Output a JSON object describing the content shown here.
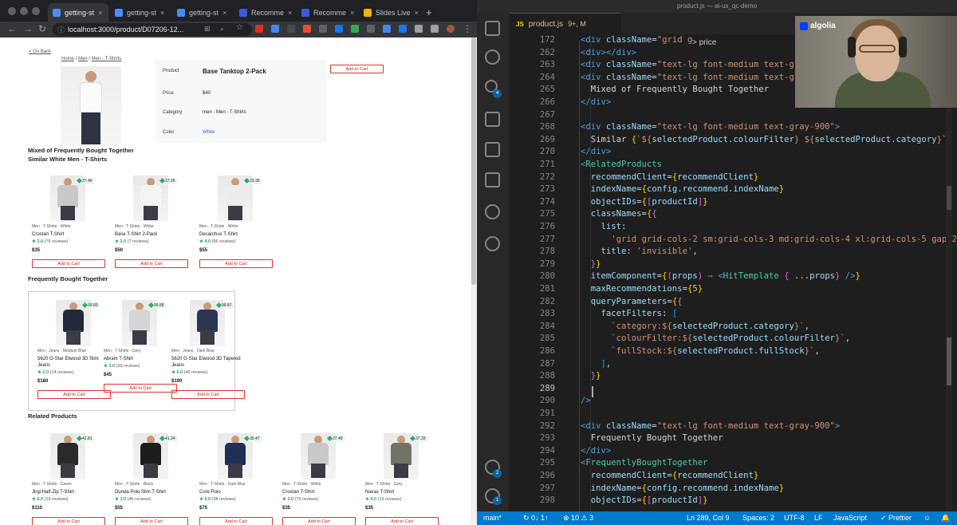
{
  "browser": {
    "tabs": [
      {
        "label": "getting-st",
        "fav": "#4a8cff"
      },
      {
        "label": "getting-st",
        "fav": "#4a8cff"
      },
      {
        "label": "getting-st",
        "fav": "#4a8cff"
      },
      {
        "label": "Recomme",
        "fav": "#3b5bdb"
      },
      {
        "label": "Recomme",
        "fav": "#3b5bdb"
      },
      {
        "label": "Slides Live",
        "fav": "#f4b400"
      }
    ],
    "new_tab": "+",
    "url": "localhost:3000/product/D07206-12..."
  },
  "page": {
    "back_link": "< Go Back",
    "breadcrumb": {
      "home": "Home",
      "sep1": " / ",
      "men": "Men",
      "sep2": " / ",
      "tshirts": "Men - T-Shirts"
    },
    "detail": {
      "product_label": "Product",
      "product_value": "Base Tanktop 2-Pack",
      "price_label": "Price",
      "price_value": "$40",
      "category_label": "Category",
      "category_value": "men - Men - T-Shirts",
      "color_label": "Color",
      "color_value": "White"
    },
    "add_to_cart": "Add to Cart",
    "heading_mixed": "Mixed of Frequently Bought Together",
    "heading_similar": "Similar White Men - T-Shirts",
    "heading_fbt": "Frequently Bought Together",
    "heading_related": "Related Products",
    "similar": [
      {
        "score": "37.49",
        "tags": "Men · T-Shirts · White",
        "name": "Crostan T-Shirt",
        "stars": "★ 2.0",
        "reviews": "(76 reviews)",
        "price": "$35",
        "shirt": "#c9c9c9"
      },
      {
        "score": "37.26",
        "tags": "Men · T-Shirts · White",
        "name": "Base T-Shirt 2-Pack",
        "stars": "★ 2.0",
        "reviews": "(7 reviews)",
        "price": "$50",
        "shirt": "#f4f4f4"
      },
      {
        "score": "23.39",
        "tags": "Men · T-Shirts · White",
        "name": "Decarchus T-Shirt",
        "stars": "★ 4.0",
        "reviews": "(56 reviews)",
        "price": "$55",
        "shirt": "#ededed"
      }
    ],
    "fbt": [
      {
        "score": "99.89",
        "tags": "Men · Jeans · Medium Blue",
        "name": "5620 G-Star Elwood 3D Slim Jeans",
        "stars": "★ 2.0",
        "reviews": "(14 reviews)",
        "price": "$180",
        "shirt": "#222a3a"
      },
      {
        "score": "99.88",
        "tags": "Men · T-Shirts · Grey",
        "name": "Abram T-Shirt",
        "stars": "★ 3.0",
        "reviews": "(59 reviews)",
        "price": "$45",
        "shirt": "#d6d6d6"
      },
      {
        "score": "99.87",
        "tags": "Men · Jeans · Dark Blue",
        "name": "5620 G-Star Elwood 3D Tapered Jeans",
        "stars": "★ 6.0",
        "reviews": "(40 reviews)",
        "price": "$190",
        "shirt": "#2b3652"
      }
    ],
    "related": [
      {
        "score": "42.81",
        "tags": "Men · T-Shirts · Green",
        "name": "Jirgi Half-Zip T-Shirt",
        "stars": "★ 6.0",
        "reviews": "(19 reviews)",
        "price": "$110",
        "shirt": "#2a2a2a"
      },
      {
        "score": "41.24",
        "tags": "Men · T-Shirts · Black",
        "name": "Dunda Polo Slim T-Shirt",
        "stars": "★ 3.0",
        "reviews": "(46 reviews)",
        "price": "$55",
        "shirt": "#1d1d1d"
      },
      {
        "score": "39.47",
        "tags": "Men · T-Shirts · Dark Blue",
        "name": "Core Polo",
        "stars": "★ 6.0",
        "reviews": "(38 reviews)",
        "price": "$75",
        "shirt": "#1f2f55"
      },
      {
        "score": "37.49",
        "tags": "Men · T-Shirts · White",
        "name": "Crostan T-Shirt",
        "stars": "★ 2.0",
        "reviews": "(76 reviews)",
        "price": "$35",
        "shirt": "#c9c9c9"
      },
      {
        "score": "37.33",
        "tags": "Men · T-Shirts · Grey",
        "name": "Navas T-Shirt",
        "stars": "★ 5.0",
        "reviews": "(16 reviews)",
        "price": "$35",
        "shirt": "#6f7466"
      }
    ]
  },
  "editor": {
    "window_title": "product.js — ai-ux_qc-demo",
    "tab_label": "product.js",
    "tab_status": "9+, M",
    "breadcrumb": "> price",
    "code_lines": [
      {
        "n": "172",
        "segs": [
          {
            "c": "t-tag",
            "t": "<div "
          },
          {
            "c": "t-attr",
            "t": "className"
          },
          {
            "c": "t-pun",
            "t": "="
          },
          {
            "c": "t-str",
            "t": "\"grid g"
          }
        ]
      },
      {
        "n": "262",
        "segs": [
          {
            "c": "t-tag",
            "t": "<div></div>"
          }
        ]
      },
      {
        "n": "263",
        "segs": [
          {
            "c": "t-tag",
            "t": "<div "
          },
          {
            "c": "t-attr",
            "t": "className"
          },
          {
            "c": "t-pun",
            "t": "="
          },
          {
            "c": "t-str",
            "t": "\"text-lg font-medium text-gra"
          }
        ]
      },
      {
        "n": "264",
        "segs": [
          {
            "c": "t-tag",
            "t": "<div "
          },
          {
            "c": "t-attr",
            "t": "className"
          },
          {
            "c": "t-pun",
            "t": "="
          },
          {
            "c": "t-str",
            "t": "\"text-lg font-medium text-gra"
          }
        ]
      },
      {
        "n": "265",
        "segs": [
          {
            "c": "t-pun",
            "t": "  Mixed of Frequently Bought Together"
          }
        ]
      },
      {
        "n": "266",
        "segs": [
          {
            "c": "t-tag",
            "t": "</div>"
          }
        ]
      },
      {
        "n": "267",
        "segs": []
      },
      {
        "n": "268",
        "segs": [
          {
            "c": "t-tag",
            "t": "<div "
          },
          {
            "c": "t-attr",
            "t": "className"
          },
          {
            "c": "t-pun",
            "t": "="
          },
          {
            "c": "t-str",
            "t": "\"text-lg font-medium text-gray-900\""
          },
          {
            "c": "t-tag",
            "t": ">"
          }
        ]
      },
      {
        "n": "269",
        "segs": [
          {
            "c": "t-pun",
            "t": "  Similar "
          },
          {
            "c": "t-br",
            "t": "{"
          },
          {
            "c": "t-str",
            "t": "`${"
          },
          {
            "c": "t-var",
            "t": "selectedProduct.colourFilter"
          },
          {
            "c": "t-str",
            "t": "} ${"
          },
          {
            "c": "t-var",
            "t": "selectedProduct.category"
          },
          {
            "c": "t-str",
            "t": "}`"
          },
          {
            "c": "t-br",
            "t": "}"
          }
        ]
      },
      {
        "n": "270",
        "segs": [
          {
            "c": "t-tag",
            "t": "</div>"
          }
        ]
      },
      {
        "n": "271",
        "segs": [
          {
            "c": "t-tag",
            "t": "<"
          },
          {
            "c": "t-cmp",
            "t": "RelatedProducts"
          }
        ]
      },
      {
        "n": "272",
        "segs": [
          {
            "c": "t-attr",
            "t": "  recommendClient"
          },
          {
            "c": "t-pun",
            "t": "="
          },
          {
            "c": "t-br",
            "t": "{"
          },
          {
            "c": "t-var",
            "t": "recommendClient"
          },
          {
            "c": "t-br",
            "t": "}"
          }
        ]
      },
      {
        "n": "273",
        "segs": [
          {
            "c": "t-attr",
            "t": "  indexName"
          },
          {
            "c": "t-pun",
            "t": "="
          },
          {
            "c": "t-br",
            "t": "{"
          },
          {
            "c": "t-var",
            "t": "config.recommend.indexName"
          },
          {
            "c": "t-br",
            "t": "}"
          }
        ]
      },
      {
        "n": "274",
        "segs": [
          {
            "c": "t-attr",
            "t": "  objectIDs"
          },
          {
            "c": "t-pun",
            "t": "="
          },
          {
            "c": "t-br",
            "t": "{"
          },
          {
            "c": "t-br2",
            "t": "["
          },
          {
            "c": "t-var",
            "t": "productId"
          },
          {
            "c": "t-br2",
            "t": "]"
          },
          {
            "c": "t-br",
            "t": "}"
          }
        ]
      },
      {
        "n": "275",
        "segs": [
          {
            "c": "t-attr",
            "t": "  classNames"
          },
          {
            "c": "t-pun",
            "t": "="
          },
          {
            "c": "t-br",
            "t": "{"
          },
          {
            "c": "t-br2",
            "t": "{"
          }
        ]
      },
      {
        "n": "276",
        "segs": [
          {
            "c": "t-var",
            "t": "    list"
          },
          {
            "c": "t-pun",
            "t": ":"
          }
        ]
      },
      {
        "n": "277",
        "segs": [
          {
            "c": "t-str",
            "t": "      'grid grid-cols-2 sm:grid-cols-3 md:grid-cols-4 xl:grid-cols-5 gap-2'"
          }
        ]
      },
      {
        "n": "278",
        "segs": [
          {
            "c": "t-var",
            "t": "    title"
          },
          {
            "c": "t-pun",
            "t": ": "
          },
          {
            "c": "t-str",
            "t": "'invisible'"
          },
          {
            "c": "t-pun",
            "t": ","
          }
        ]
      },
      {
        "n": "279",
        "segs": [
          {
            "c": "t-br2",
            "t": "  }"
          },
          {
            "c": "t-br",
            "t": "}"
          }
        ]
      },
      {
        "n": "280",
        "segs": [
          {
            "c": "t-attr",
            "t": "  itemComponent"
          },
          {
            "c": "t-pun",
            "t": "="
          },
          {
            "c": "t-br",
            "t": "{"
          },
          {
            "c": "t-br2",
            "t": "("
          },
          {
            "c": "t-var",
            "t": "props"
          },
          {
            "c": "t-br2",
            "t": ")"
          },
          {
            "c": "t-tag",
            "t": " ⇒ <"
          },
          {
            "c": "t-cmp",
            "t": "HitTemplate"
          },
          {
            "c": "t-br2",
            "t": " {"
          },
          {
            "c": "t-pun",
            "t": " ..."
          },
          {
            "c": "t-var",
            "t": "props"
          },
          {
            "c": "t-br2",
            "t": "}"
          },
          {
            "c": "t-tag",
            "t": " />"
          },
          {
            "c": "t-br",
            "t": "}"
          }
        ]
      },
      {
        "n": "281",
        "segs": [
          {
            "c": "t-attr",
            "t": "  maxRecommendations"
          },
          {
            "c": "t-pun",
            "t": "="
          },
          {
            "c": "t-br",
            "t": "{"
          },
          {
            "c": "t-num",
            "t": "5"
          },
          {
            "c": "t-br",
            "t": "}"
          }
        ]
      },
      {
        "n": "282",
        "segs": [
          {
            "c": "t-attr",
            "t": "  queryParameters"
          },
          {
            "c": "t-pun",
            "t": "="
          },
          {
            "c": "t-br",
            "t": "{"
          },
          {
            "c": "t-br2",
            "t": "{"
          }
        ]
      },
      {
        "n": "283",
        "segs": [
          {
            "c": "t-var",
            "t": "    facetFilters"
          },
          {
            "c": "t-pun",
            "t": ": "
          },
          {
            "c": "t-br3",
            "t": "["
          }
        ]
      },
      {
        "n": "284",
        "segs": [
          {
            "c": "t-str",
            "t": "      `category:${"
          },
          {
            "c": "t-var",
            "t": "selectedProduct.category"
          },
          {
            "c": "t-str",
            "t": "}`"
          },
          {
            "c": "t-pun",
            "t": ","
          }
        ]
      },
      {
        "n": "285",
        "segs": [
          {
            "c": "t-str",
            "t": "      `colourFilter:${"
          },
          {
            "c": "t-var",
            "t": "selectedProduct.colourFilter"
          },
          {
            "c": "t-str",
            "t": "}`"
          },
          {
            "c": "t-pun",
            "t": ","
          }
        ]
      },
      {
        "n": "286",
        "segs": [
          {
            "c": "t-str",
            "t": "      `fullStock:${"
          },
          {
            "c": "t-var",
            "t": "selectedProduct.fullStock"
          },
          {
            "c": "t-str",
            "t": "}`"
          },
          {
            "c": "t-pun",
            "t": ","
          }
        ]
      },
      {
        "n": "287",
        "segs": [
          {
            "c": "t-br3",
            "t": "    ]"
          },
          {
            "c": "t-pun",
            "t": ","
          }
        ]
      },
      {
        "n": "288",
        "segs": [
          {
            "c": "t-br2",
            "t": "  }"
          },
          {
            "c": "t-br",
            "t": "}"
          }
        ]
      },
      {
        "n": "289",
        "segs": []
      },
      {
        "n": "290",
        "segs": [
          {
            "c": "t-tag",
            "t": "/>"
          }
        ]
      },
      {
        "n": "291",
        "segs": []
      },
      {
        "n": "292",
        "segs": [
          {
            "c": "t-tag",
            "t": "<div "
          },
          {
            "c": "t-attr",
            "t": "className"
          },
          {
            "c": "t-pun",
            "t": "="
          },
          {
            "c": "t-str",
            "t": "\"text-lg font-medium text-gray-900\""
          },
          {
            "c": "t-tag",
            "t": ">"
          }
        ]
      },
      {
        "n": "293",
        "segs": [
          {
            "c": "t-pun",
            "t": "  Frequently Bought Together"
          }
        ]
      },
      {
        "n": "294",
        "segs": [
          {
            "c": "t-tag",
            "t": "</div>"
          }
        ]
      },
      {
        "n": "295",
        "segs": [
          {
            "c": "t-tag",
            "t": "<"
          },
          {
            "c": "t-cmp",
            "t": "FrequentlyBoughtTogether"
          }
        ]
      },
      {
        "n": "296",
        "segs": [
          {
            "c": "t-attr",
            "t": "  recommendClient"
          },
          {
            "c": "t-pun",
            "t": "="
          },
          {
            "c": "t-br",
            "t": "{"
          },
          {
            "c": "t-var",
            "t": "recommendClient"
          },
          {
            "c": "t-br",
            "t": "}"
          }
        ]
      },
      {
        "n": "297",
        "segs": [
          {
            "c": "t-attr",
            "t": "  indexName"
          },
          {
            "c": "t-pun",
            "t": "="
          },
          {
            "c": "t-br",
            "t": "{"
          },
          {
            "c": "t-var",
            "t": "config.recommend.indexName"
          },
          {
            "c": "t-br",
            "t": "}"
          }
        ]
      },
      {
        "n": "298",
        "segs": [
          {
            "c": "t-attr",
            "t": "  objectIDs"
          },
          {
            "c": "t-pun",
            "t": "="
          },
          {
            "c": "t-br",
            "t": "{"
          },
          {
            "c": "t-br2",
            "t": "["
          },
          {
            "c": "t-var",
            "t": "productId"
          },
          {
            "c": "t-br2",
            "t": "]"
          },
          {
            "c": "t-br",
            "t": "}"
          }
        ]
      }
    ],
    "current_line": "289",
    "status": {
      "branch": "main*",
      "sync": "↻ 0↓ 1↑",
      "problems": "⊗ 10 ⚠ 3",
      "position": "Ln 289, Col 9",
      "spaces": "Spaces: 2",
      "encoding": "UTF-8",
      "eol": "LF",
      "language": "JavaScript",
      "prettier": "✓ Prettier"
    },
    "activity_badges": {
      "scm": "4",
      "accounts": "2",
      "settings": "1"
    }
  },
  "webcam": {
    "brand": "algolia"
  }
}
